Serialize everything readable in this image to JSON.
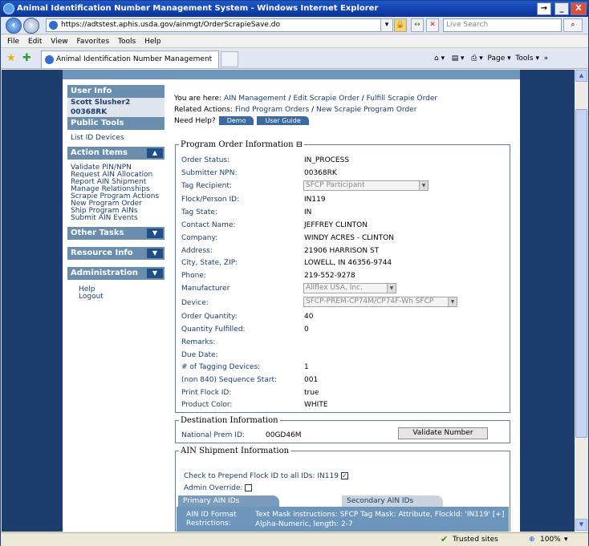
{
  "window": {
    "title": "Animal Identification Number Management System - Windows Internet Explorer",
    "min": "_",
    "max": "□",
    "close": "X",
    "back_arrow": "→"
  },
  "address": {
    "url": "https://adtstest.aphis.usda.gov/ainmgt/OrderScrapieSave.do",
    "search_placeholder": "Live Search",
    "go": "↔",
    "stop": "✕"
  },
  "menu": [
    "File",
    "Edit",
    "View",
    "Favorites",
    "Tools",
    "Help"
  ],
  "tab": {
    "label": "Animal Identification Number Management System"
  },
  "ie_tools": {
    "page": "Page ▾",
    "tools": "Tools ▾",
    "overflow": "»"
  },
  "status": {
    "zone": "Trusted sites",
    "zoom": "100%"
  },
  "sidebar": {
    "user_info": "User Info",
    "user_name": "Scott Slusher2",
    "user_id": "00368RK",
    "public_tools": "Public Tools",
    "public_items": [
      "List ID Devices"
    ],
    "action_items": "Action Items",
    "action_list": [
      "Validate PIN/NPN",
      "Request AIN Allocation",
      "Report AIN Shipment",
      "Manage Relationships",
      "Scrapie Program Actions",
      "New Program Order",
      "Ship Program AINs",
      "Submit AIN Events"
    ],
    "other_tasks": "Other Tasks",
    "resource_info": "Resource Info",
    "administration": "Administration",
    "admin_items": [
      "Help",
      "Logout"
    ],
    "up": "▲",
    "down": "▼"
  },
  "breadcrumb": {
    "prefix": "You are here:",
    "items": [
      "AIN Management",
      "Edit Scrapie Order",
      "Fulfill Scrapie Order"
    ]
  },
  "related": {
    "prefix": "Related Actions:",
    "items": [
      "Find Program Orders",
      "New Scrapie Program Order"
    ]
  },
  "help": {
    "prefix": "Need Help?",
    "demo": "Demo",
    "guide": "User Guide"
  },
  "order": {
    "legend": "Program Order Information",
    "collapse": "⊟",
    "fields": [
      {
        "label": "Order Status:",
        "value": "IN_PROCESS"
      },
      {
        "label": "Submitter NPN:",
        "value": "00368RK"
      },
      {
        "label": "Tag Recipient:",
        "value": "SFCP Participant"
      },
      {
        "label": "Flock/Person ID:",
        "value": "IN119"
      },
      {
        "label": "Tag State:",
        "value": "IN"
      },
      {
        "label": "Contact Name:",
        "value": "JEFFREY CLINTON"
      },
      {
        "label": "Company:",
        "value": "WINDY ACRES - CLINTON"
      },
      {
        "label": "Address:",
        "value": "21906 HARRISON ST"
      },
      {
        "label": "City, State, ZIP:",
        "value": "LOWELL, IN 46356-9744"
      },
      {
        "label": "Phone:",
        "value": "219-552-9278"
      },
      {
        "label": "Manufacturer",
        "value": "Allflex USA, Inc."
      },
      {
        "label": "Device:",
        "value": "SFCP-PREM-CP74M/CP74F-Wh SFCP"
      },
      {
        "label": "Order Quantity:",
        "value": "40"
      },
      {
        "label": "Quantity Fulfilled:",
        "value": "0"
      },
      {
        "label": "Remarks:",
        "value": ""
      },
      {
        "label": "Due Date:",
        "value": ""
      },
      {
        "label": "# of Tagging Devices:",
        "value": "1"
      },
      {
        "label": "(non 840) Sequence Start:",
        "value": "001"
      },
      {
        "label": "Print Flock ID:",
        "value": "true"
      },
      {
        "label": "Product Color:",
        "value": "WHITE"
      }
    ]
  },
  "destination": {
    "legend": "Destination Information",
    "label": "National Prem ID:",
    "value": "00GD46M",
    "validate": "Validate Number"
  },
  "shipment": {
    "legend": "AIN Shipment Information",
    "prepend": "Check to Prepend Flock ID to all IDs: IN119",
    "override": "Admin Override:",
    "tab_primary": "Primary AIN IDs",
    "tab_secondary": "Secondary AIN IDs",
    "format_label": "AIN ID Format Restrictions:",
    "format_text1": "Text Mask instructions: SFCP Tag Mask: Attribute, FlockId: 'IN119' [+]",
    "format_text2": "Alpha-Numeric, length: 2-7",
    "checked": "✓"
  }
}
